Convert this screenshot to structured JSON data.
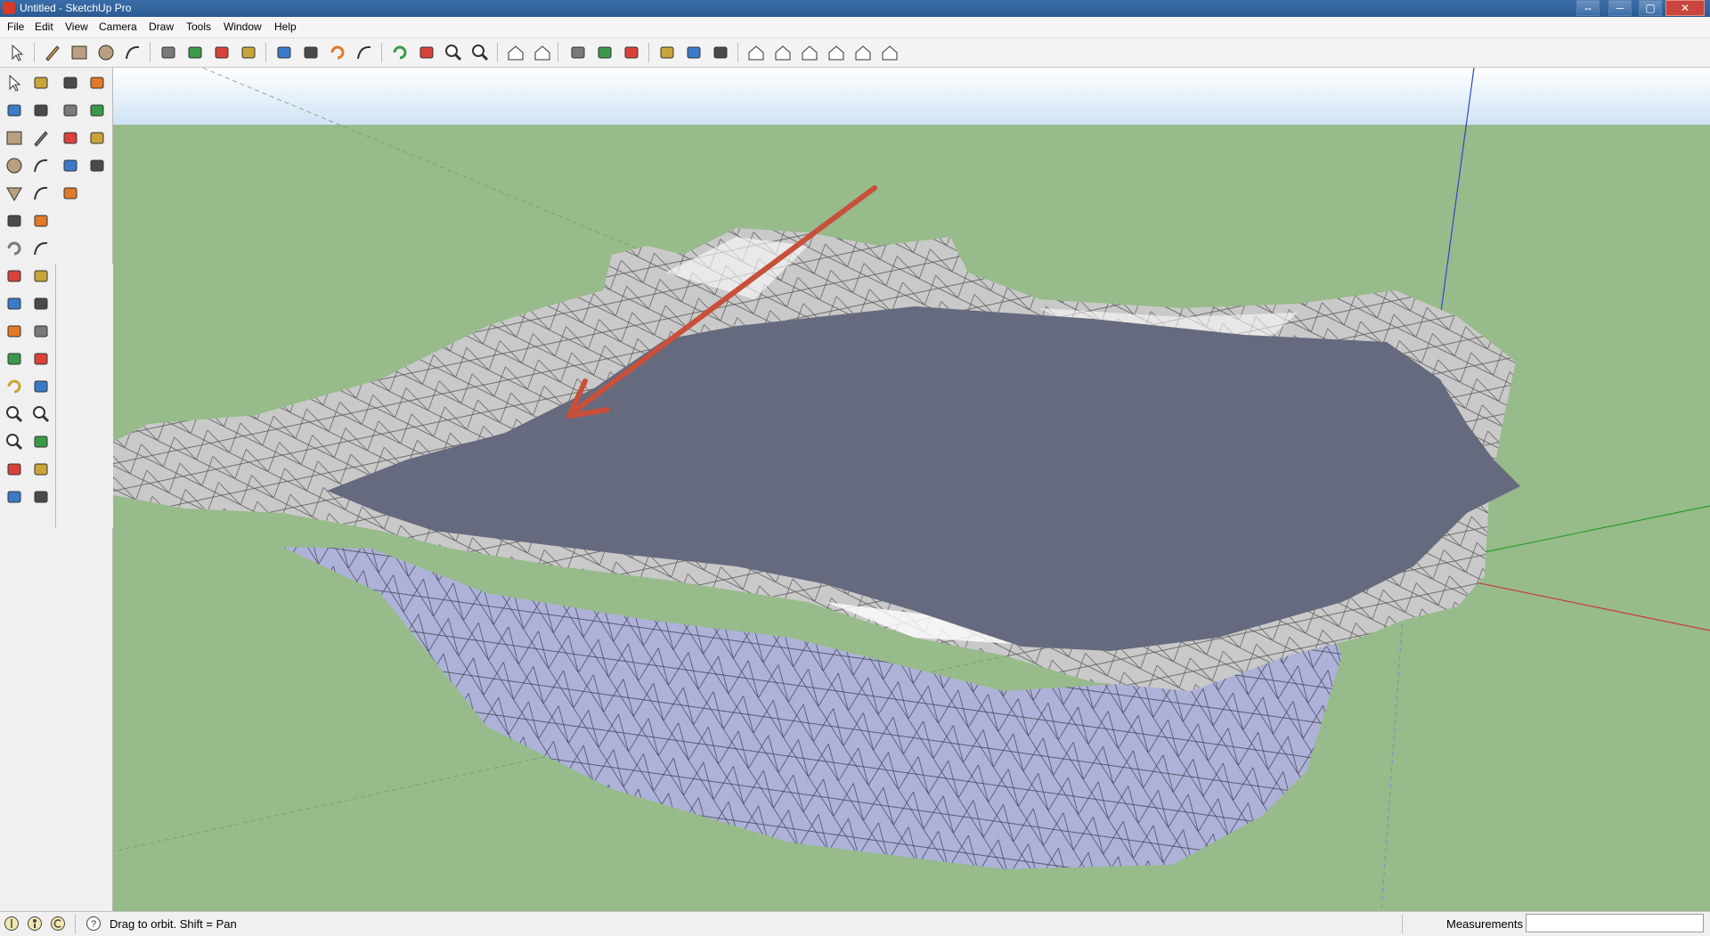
{
  "window": {
    "title": "Untitled - SketchUp Pro",
    "controls": [
      "⇔",
      "─",
      "▢",
      "✕"
    ]
  },
  "menu": [
    "File",
    "Edit",
    "View",
    "Camera",
    "Draw",
    "Tools",
    "Window",
    "Help"
  ],
  "toolbar": {
    "icons": [
      "select-icon",
      "pencil-icon",
      "rectangle-icon",
      "circle-icon",
      "arc-icon",
      "make-component-icon",
      "eraser-icon",
      "tape-measure-icon",
      "paint-bucket-icon",
      "push-pull-icon",
      "move-icon",
      "rotate-icon",
      "follow-me-icon",
      "orbit-icon",
      "pan-icon",
      "zoom-icon",
      "zoom-extents-icon",
      "previous-view-icon",
      "next-view-icon",
      "get-models-icon",
      "share-model-icon",
      "3d-warehouse-icon",
      "add-location-icon",
      "toggle-terrain-icon",
      "photo-textures-icon",
      "iso-view-icon",
      "top-view-icon",
      "front-view-icon",
      "right-view-icon",
      "back-view-icon",
      "left-view-icon"
    ]
  },
  "left_tools": [
    "select-icon",
    "make-component-icon",
    "paint-bucket-icon",
    "eraser-icon",
    "rectangle-icon",
    "line-icon",
    "circle-icon",
    "arc-icon",
    "polygon-icon",
    "freehand-icon",
    "move-icon",
    "push-pull-icon",
    "rotate-icon",
    "follow-me-icon",
    "scale-icon",
    "offset-icon",
    "tape-measure-icon",
    "dimension-icon",
    "protractor-icon",
    "text-icon",
    "axes-icon",
    "3d-text-icon",
    "orbit-icon",
    "pan-icon",
    "zoom-icon",
    "zoom-window-icon",
    "zoom-extents-icon",
    "previous-icon",
    "position-camera-icon",
    "look-around-icon",
    "walk-icon",
    "section-plane-icon"
  ],
  "side_tools": [
    "outer-shell-icon",
    "intersect-icon",
    "union-icon",
    "subtract-icon",
    "trim-icon",
    "split-icon",
    "sandbox-from-contours-icon",
    "stamp-icon",
    "drape-icon"
  ],
  "scene": {
    "sky_color": "#cfe3f5",
    "ground_color": "#97bb8a",
    "water_color": "#666a7e",
    "terrain_color": "#c9c9c9",
    "side_color": "#aeb2d8",
    "arrow_color": "#c8503a"
  },
  "status": {
    "hint": "Drag to orbit.  Shift = Pan",
    "measurements_label": "Measurements",
    "measurements_value": ""
  }
}
